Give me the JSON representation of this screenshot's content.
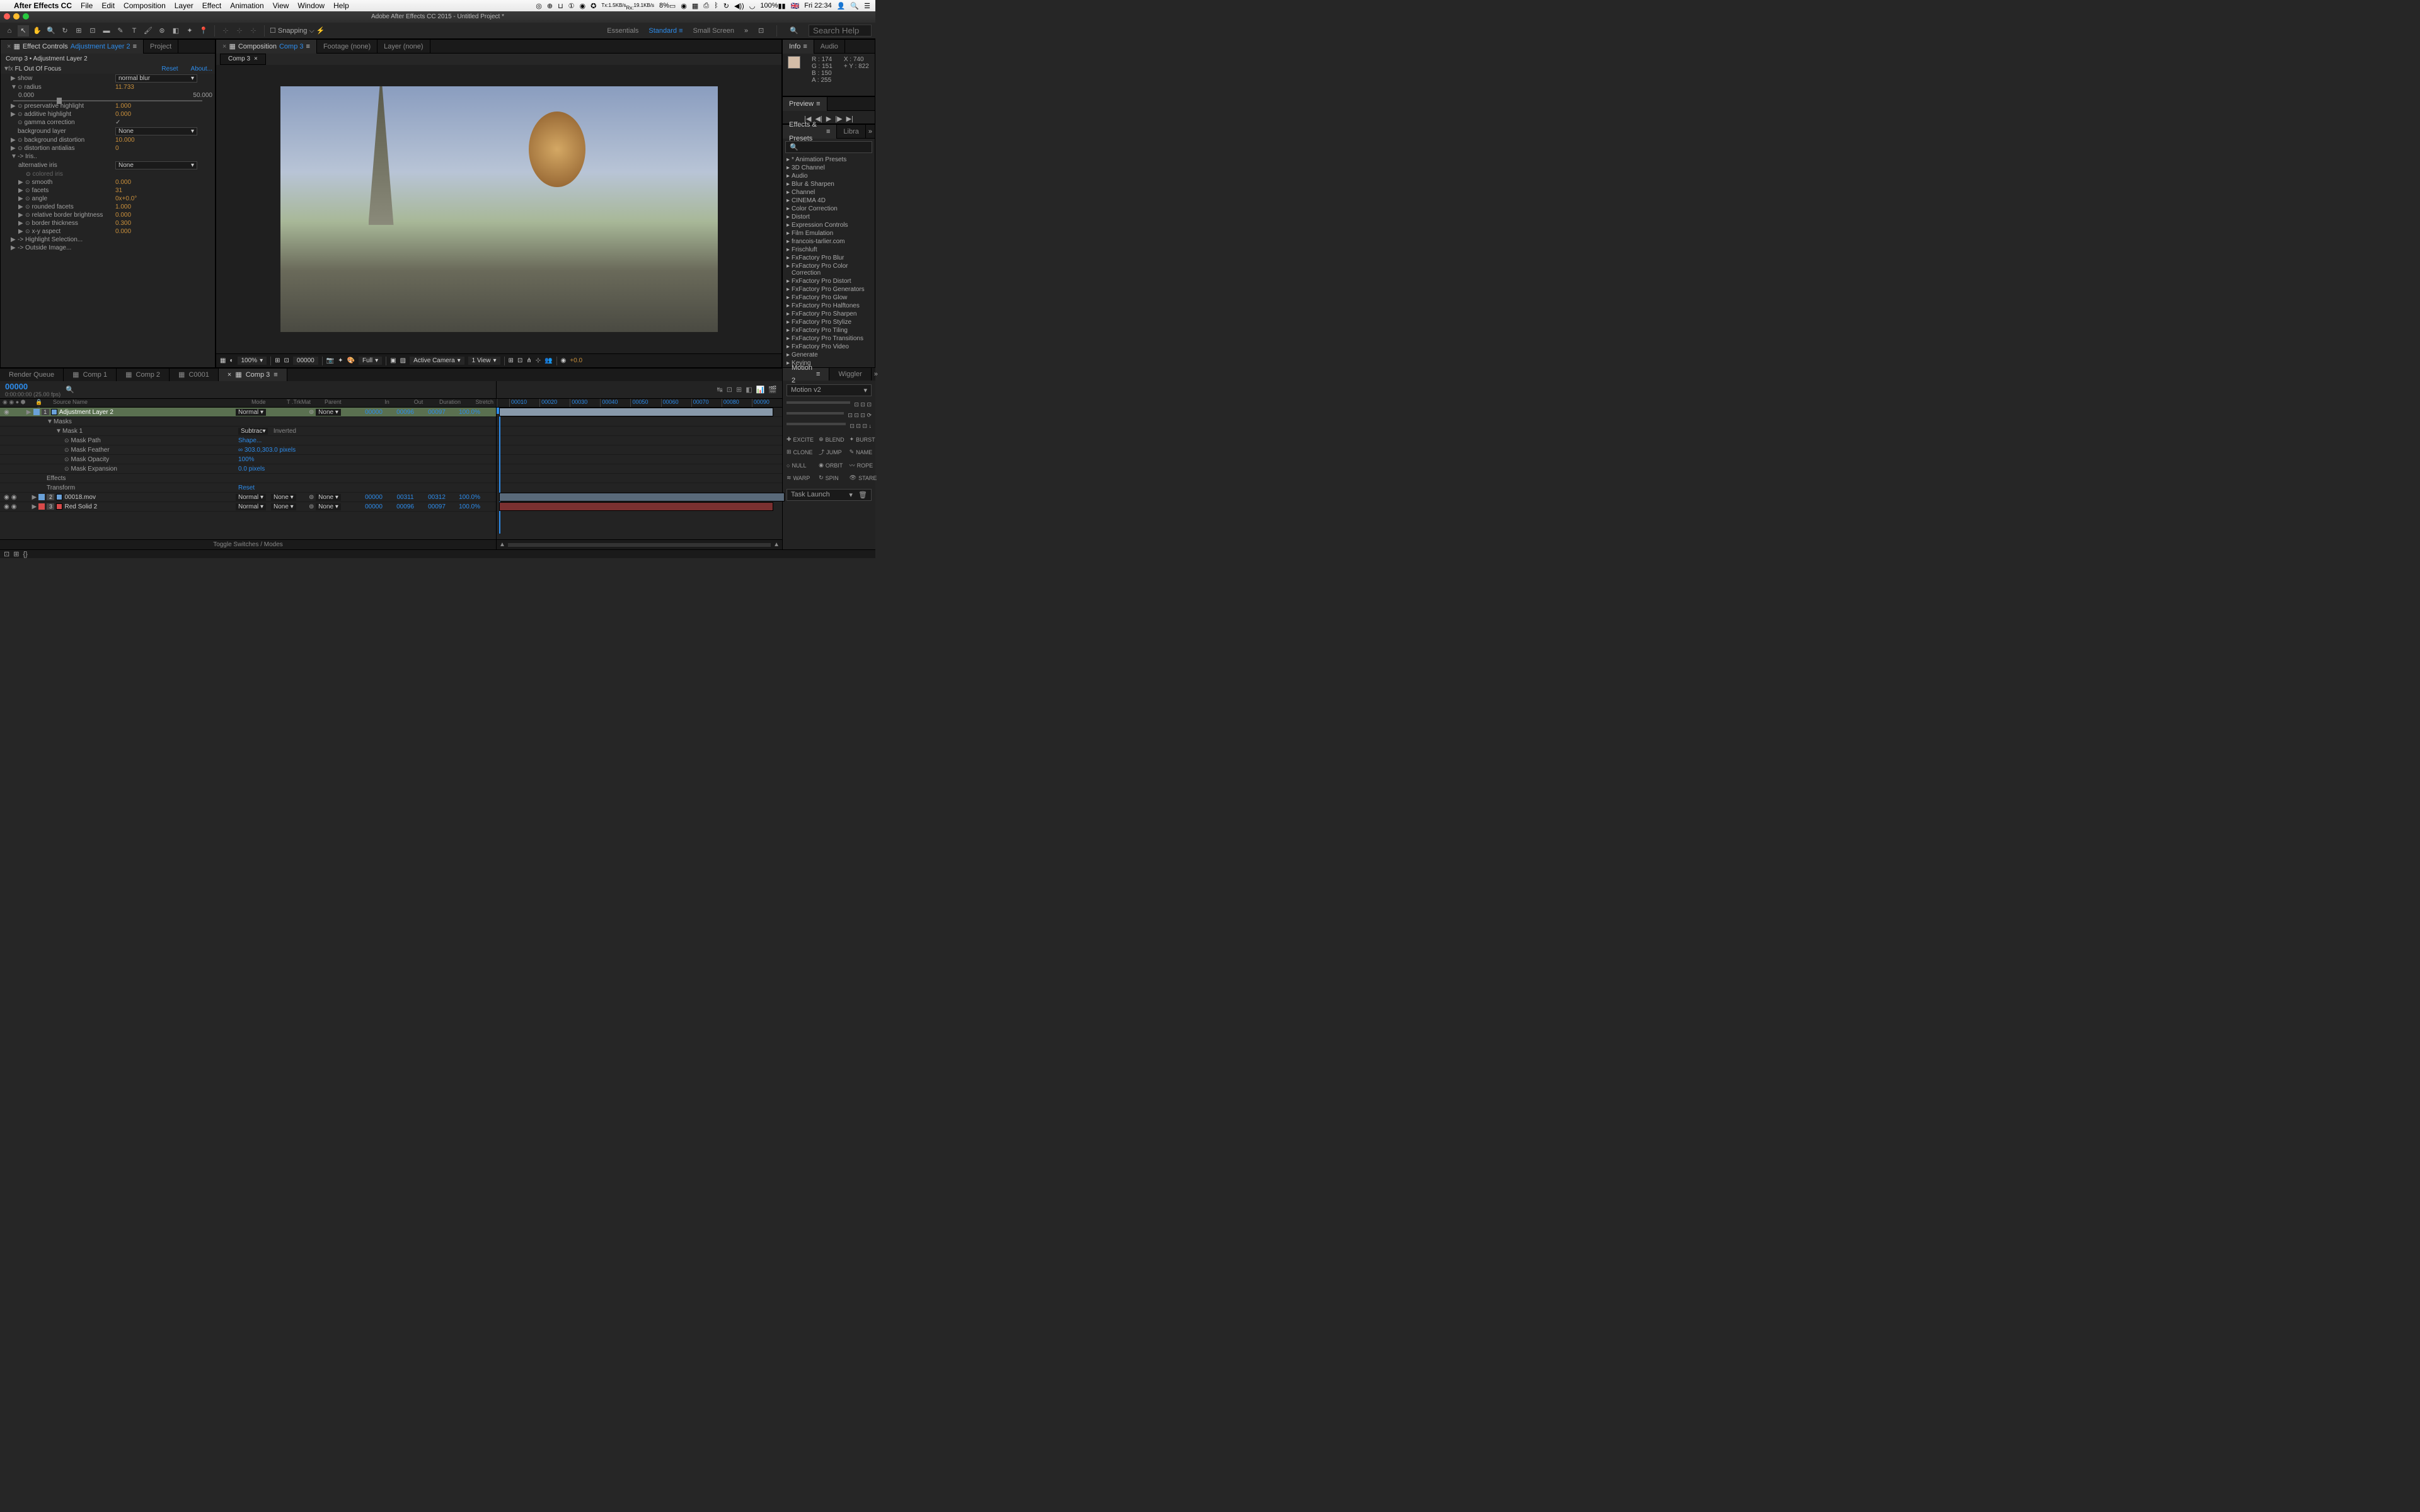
{
  "menubar": {
    "app": "After Effects CC",
    "items": [
      "File",
      "Edit",
      "Composition",
      "Layer",
      "Effect",
      "Animation",
      "View",
      "Window",
      "Help"
    ],
    "net_up": "1.5KB/s",
    "net_dn": "19.1KB/s",
    "battery": "8%",
    "volume": "100%",
    "flag": "🇬🇧",
    "time": "Fri 22:34"
  },
  "window": {
    "title": "Adobe After Effects CC 2015 - Untitled Project *"
  },
  "toolbar": {
    "snapping": "Snapping",
    "workspaces": [
      "Essentials",
      "Standard",
      "Small Screen"
    ],
    "active_ws": "Standard",
    "search_placeholder": "Search Help"
  },
  "left_panel": {
    "tab1": "Effect Controls",
    "tab1_layer": "Adjustment Layer 2",
    "tab2": "Project",
    "breadcrumb": "Comp 3 • Adjustment Layer 2",
    "fx": {
      "name": "FL Out Of Focus",
      "reset": "Reset",
      "about": "About...",
      "params": {
        "show": {
          "label": "show",
          "value": "normal blur"
        },
        "radius": {
          "label": "radius",
          "value": "11.733",
          "min": "0.000",
          "max": "50.000"
        },
        "preservative_highlight": {
          "label": "preservative highlight",
          "value": "1.000"
        },
        "additive_highlight": {
          "label": "additive highlight",
          "value": "0.000"
        },
        "gamma_correction": {
          "label": "gamma correction",
          "value": "✓"
        },
        "background_layer": {
          "label": "background layer",
          "value": "None"
        },
        "background_distortion": {
          "label": "background distortion",
          "value": "10.000"
        },
        "distortion_antialias": {
          "label": "distortion antialias",
          "value": "0"
        },
        "iris": {
          "label": "-> Iris.."
        },
        "alternative_iris": {
          "label": "alternative iris",
          "value": "None"
        },
        "colored_iris": {
          "label": "colored iris"
        },
        "smooth": {
          "label": "smooth",
          "value": "0.000"
        },
        "facets": {
          "label": "facets",
          "value": "31"
        },
        "angle": {
          "label": "angle",
          "value": "0x+0.0°"
        },
        "rounded_facets": {
          "label": "rounded facets",
          "value": "1.000"
        },
        "relative_border_brightness": {
          "label": "relative border brightness",
          "value": "0.000"
        },
        "border_thickness": {
          "label": "border thickness",
          "value": "0.300"
        },
        "xy_aspect": {
          "label": "x-y aspect",
          "value": "0.000"
        },
        "highlight_selection": {
          "label": "-> Highlight Selection..."
        },
        "outside_image": {
          "label": "-> Outside Image..."
        }
      }
    }
  },
  "center": {
    "tab_comp": "Composition",
    "tab_comp_name": "Comp 3",
    "tab_footage": "Footage (none)",
    "tab_layer": "Layer (none)",
    "sub_tab": "Comp 3",
    "viewbar": {
      "zoom": "100%",
      "time": "00000",
      "res": "Full",
      "camera": "Active Camera",
      "views": "1 View",
      "exposure": "+0.0"
    }
  },
  "info": {
    "title": "Info",
    "audio_tab": "Audio",
    "R": "174",
    "G": "151",
    "B": "150",
    "A": "255",
    "X": "740",
    "Y": "822"
  },
  "preview": {
    "title": "Preview"
  },
  "effects_presets": {
    "title": "Effects & Presets",
    "tab2": "Libra",
    "items": [
      "* Animation Presets",
      "3D Channel",
      "Audio",
      "Blur & Sharpen",
      "Channel",
      "CINEMA 4D",
      "Color Correction",
      "Distort",
      "Expression Controls",
      "Film Emulation",
      "francois-tarlier.com",
      "Frischluft",
      "FxFactory Pro Blur",
      "FxFactory Pro Color Correction",
      "FxFactory Pro Distort",
      "FxFactory Pro Generators",
      "FxFactory Pro Glow",
      "FxFactory Pro Halftones",
      "FxFactory Pro Sharpen",
      "FxFactory Pro Stylize",
      "FxFactory Pro Tiling",
      "FxFactory Pro Transitions",
      "FxFactory Pro Video",
      "Generate",
      "Keying"
    ]
  },
  "timeline": {
    "tabs": [
      "Render Queue",
      "Comp 1",
      "Comp 2",
      "C0001",
      "Comp 3"
    ],
    "active_tab": "Comp 3",
    "timecode": "00000",
    "fps": "0:00:00:00 (25.00 fps)",
    "columns": {
      "source": "Source Name",
      "mode": "Mode",
      "trkmat": "T .TrkMat",
      "parent": "Parent",
      "in": "In",
      "out": "Out",
      "duration": "Duration",
      "stretch": "Stretch"
    },
    "ruler": [
      "00010",
      "00020",
      "00030",
      "00040",
      "00050",
      "00060",
      "00070",
      "00080",
      "00090"
    ],
    "layers": [
      {
        "num": "1",
        "color": "#6aa1d8",
        "name": "Adjustment Layer 2",
        "mode": "Normal",
        "parent": "None",
        "in": "00000",
        "out": "00096",
        "dur": "00097",
        "stretch": "100.0%",
        "selected": true,
        "children": [
          {
            "name": "Masks",
            "expand": true
          },
          {
            "name": "Mask 1",
            "mode": "Subtrac",
            "inverted": "Inverted",
            "indent": 2,
            "expand": true
          },
          {
            "name": "Mask Path",
            "value": "Shape...",
            "indent": 3,
            "sw": true
          },
          {
            "name": "Mask Feather",
            "value": "∞ 303.0,303.0 pixels",
            "indent": 3,
            "sw": true
          },
          {
            "name": "Mask Opacity",
            "value": "100%",
            "indent": 3,
            "sw": true
          },
          {
            "name": "Mask Expansion",
            "value": "0.0 pixels",
            "indent": 3,
            "sw": true
          },
          {
            "name": "Effects",
            "indent": 1
          },
          {
            "name": "Transform",
            "value": "Reset",
            "indent": 1
          }
        ]
      },
      {
        "num": "2",
        "color": "#6aa1d8",
        "name": "00018.mov",
        "mode": "Normal",
        "trkmat": "None",
        "parent": "None",
        "in": "00000",
        "out": "00311",
        "dur": "00312",
        "stretch": "100.0%"
      },
      {
        "num": "3",
        "color": "#d84a4a",
        "name": "Red Solid 2",
        "mode": "Normal",
        "trkmat": "None",
        "parent": "None",
        "in": "00000",
        "out": "00096",
        "dur": "00097",
        "stretch": "100.0%"
      }
    ],
    "footer": "Toggle Switches / Modes"
  },
  "motion": {
    "tab1": "Motion 2",
    "tab2": "Wiggler",
    "preset": "Motion v2",
    "buttons": [
      "EXCITE",
      "BLEND",
      "BURST",
      "CLONE",
      "JUMP",
      "NAME",
      "NULL",
      "ORBIT",
      "ROPE",
      "WARP",
      "SPIN",
      "STARE"
    ],
    "task_launch": "Task Launch"
  }
}
